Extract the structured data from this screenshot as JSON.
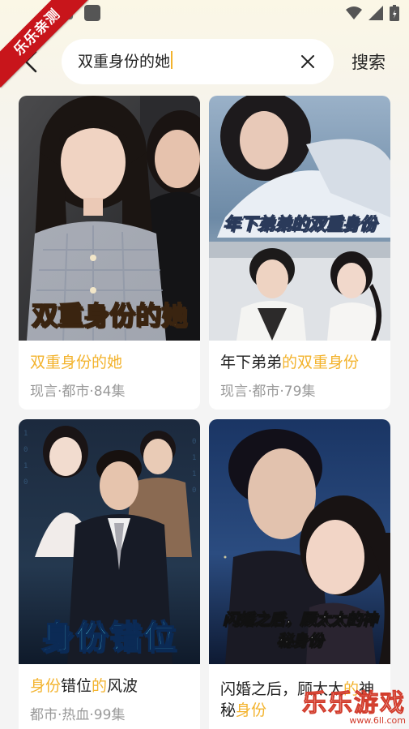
{
  "ribbon": {
    "label": "乐乐亲测"
  },
  "search": {
    "query": "双重身份的她",
    "submit_label": "搜索"
  },
  "results": [
    {
      "poster_title": "双重身份的她",
      "title_parts": [
        {
          "text": "双重身份的她",
          "highlight": true
        }
      ],
      "meta": "现言·都市·84集"
    },
    {
      "poster_title": "年下弟弟的双重身份",
      "title_parts": [
        {
          "text": "年下弟弟",
          "highlight": false
        },
        {
          "text": "的双重身份",
          "highlight": true
        }
      ],
      "meta": "现言·都市·79集"
    },
    {
      "poster_title": "身份错位",
      "title_parts": [
        {
          "text": "身份",
          "highlight": true
        },
        {
          "text": "错位",
          "highlight": false
        },
        {
          "text": "的",
          "highlight": true
        },
        {
          "text": "风波",
          "highlight": false
        }
      ],
      "meta": "都市·热血·99集"
    },
    {
      "poster_title": "闪婚之后，顾太太的神秘身份",
      "title_parts": [
        {
          "text": "闪婚之后，顾太太",
          "highlight": false
        },
        {
          "text": "的",
          "highlight": true
        },
        {
          "text": "神秘",
          "highlight": false
        },
        {
          "text": "身份",
          "highlight": true
        }
      ],
      "meta": ""
    }
  ],
  "watermark": {
    "main": "乐乐游戏",
    "url": "www.6ll.com"
  },
  "colors": {
    "highlight": "#f3b32d",
    "ribbon": "#c8151b",
    "meta": "#999999"
  }
}
